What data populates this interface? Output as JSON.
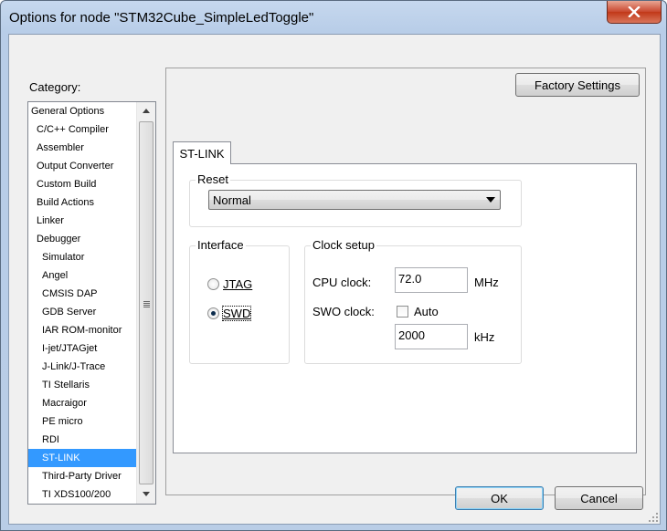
{
  "window": {
    "title": "Options for node \"STM32Cube_SimpleLedToggle\""
  },
  "category": {
    "label": "Category:",
    "items": [
      {
        "label": "General Options",
        "level": 0
      },
      {
        "label": "C/C++ Compiler",
        "level": 1
      },
      {
        "label": "Assembler",
        "level": 1
      },
      {
        "label": "Output Converter",
        "level": 1
      },
      {
        "label": "Custom Build",
        "level": 1
      },
      {
        "label": "Build Actions",
        "level": 1
      },
      {
        "label": "Linker",
        "level": 1
      },
      {
        "label": "Debugger",
        "level": 1
      },
      {
        "label": "Simulator",
        "level": 2
      },
      {
        "label": "Angel",
        "level": 2
      },
      {
        "label": "CMSIS DAP",
        "level": 2
      },
      {
        "label": "GDB Server",
        "level": 2
      },
      {
        "label": "IAR ROM-monitor",
        "level": 2
      },
      {
        "label": "I-jet/JTAGjet",
        "level": 2
      },
      {
        "label": "J-Link/J-Trace",
        "level": 2
      },
      {
        "label": "TI Stellaris",
        "level": 2
      },
      {
        "label": "Macraigor",
        "level": 2
      },
      {
        "label": "PE micro",
        "level": 2
      },
      {
        "label": "RDI",
        "level": 2
      },
      {
        "label": "ST-LINK",
        "level": 2,
        "selected": true
      },
      {
        "label": "Third-Party Driver",
        "level": 2
      },
      {
        "label": "TI XDS100/200",
        "level": 2
      }
    ]
  },
  "panel": {
    "factory_settings_label": "Factory Settings",
    "tab_label": "ST-LINK",
    "reset": {
      "legend": "Reset",
      "value": "Normal"
    },
    "interface": {
      "legend": "Interface",
      "jtag_label": "JTAG",
      "swd_label": "SWD",
      "selected": "SWD"
    },
    "clock": {
      "legend": "Clock setup",
      "cpu_label": "CPU clock:",
      "cpu_value": "72.0",
      "cpu_unit": "MHz",
      "swo_label": "SWO clock:",
      "auto_label": "Auto",
      "auto_checked": false,
      "swo_value": "2000",
      "swo_unit": "kHz"
    }
  },
  "buttons": {
    "ok": "OK",
    "cancel": "Cancel"
  },
  "colors": {
    "selection": "#3399ff",
    "close_button": "#c9472e"
  }
}
